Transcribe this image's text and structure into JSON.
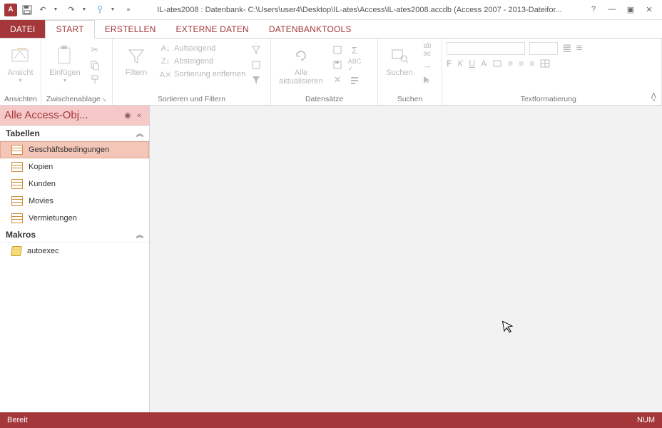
{
  "title": "IL-ates2008 : Datenbank- C:\\Users\\user4\\Desktop\\IL-ates\\Access\\IL-ates2008.accdb (Access 2007 - 2013-Dateifor...",
  "tabs": {
    "datei": "DATEI",
    "start": "START",
    "erstellen": "ERSTELLEN",
    "externe": "EXTERNE DATEN",
    "tools": "DATENBANKTOOLS"
  },
  "ribbon": {
    "ansichten": {
      "label": "Ansichten",
      "ansicht": "Ansicht"
    },
    "zwischenablage": {
      "label": "Zwischenablage",
      "einfuegen": "Einfügen"
    },
    "sortieren": {
      "label": "Sortieren und Filtern",
      "filtern": "Filtern",
      "aufsteigend": "Aufsteigend",
      "absteigend": "Absteigend",
      "entfernen": "Sortierung entfernen"
    },
    "datensaetze": {
      "label": "Datensätze",
      "aktualisieren": "Alle\naktualisieren"
    },
    "suchen": {
      "label": "Suchen",
      "suchen": "Suchen"
    },
    "textformat": {
      "label": "Textformatierung"
    }
  },
  "nav": {
    "header": "Alle Access-Obj...",
    "tabellen_label": "Tabellen",
    "makros_label": "Makros",
    "tables": [
      "Geschäftsbedingungen",
      "Kopien",
      "Kunden",
      "Movies",
      "Vermietungen"
    ],
    "macros": [
      "autoexec"
    ]
  },
  "status": {
    "ready": "Bereit",
    "num": "NUM"
  }
}
